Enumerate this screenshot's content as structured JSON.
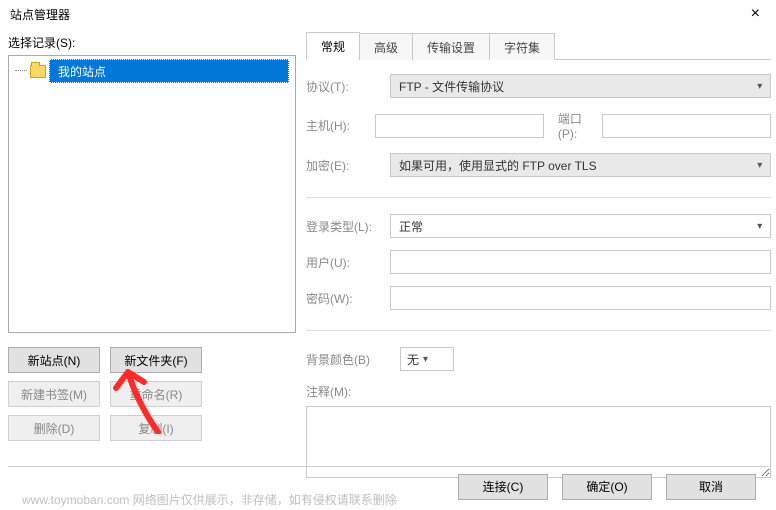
{
  "window": {
    "title": "站点管理器",
    "close": "×"
  },
  "left": {
    "select_label": "选择记录(S):",
    "tree": {
      "root_label": "我的站点"
    },
    "buttons": {
      "new_site": "新站点(N)",
      "new_folder": "新文件夹(F)",
      "new_bookmark": "新建书签(M)",
      "rename": "重命名(R)",
      "delete": "删除(D)",
      "copy": "复制(I)"
    }
  },
  "tabs": {
    "general": "常规",
    "advanced": "高级",
    "transfer": "传输设置",
    "charset": "字符集"
  },
  "form": {
    "protocol_label": "协议(T):",
    "protocol_value": "FTP - 文件传输协议",
    "host_label": "主机(H):",
    "host_value": "",
    "port_label": "端口(P):",
    "port_value": "",
    "encryption_label": "加密(E):",
    "encryption_value": "如果可用，使用显式的 FTP over TLS",
    "logon_label": "登录类型(L):",
    "logon_value": "正常",
    "user_label": "用户(U):",
    "user_value": "",
    "password_label": "密码(W):",
    "password_value": "",
    "bgcolor_label": "背景颜色(B)",
    "bgcolor_value": "无",
    "notes_label": "注释(M):",
    "notes_value": ""
  },
  "bottom": {
    "connect": "连接(C)",
    "ok": "确定(O)",
    "cancel": "取消"
  },
  "watermark": "www.toymoban.com  网络图片仅供展示，非存储，如有侵权请联系删除"
}
